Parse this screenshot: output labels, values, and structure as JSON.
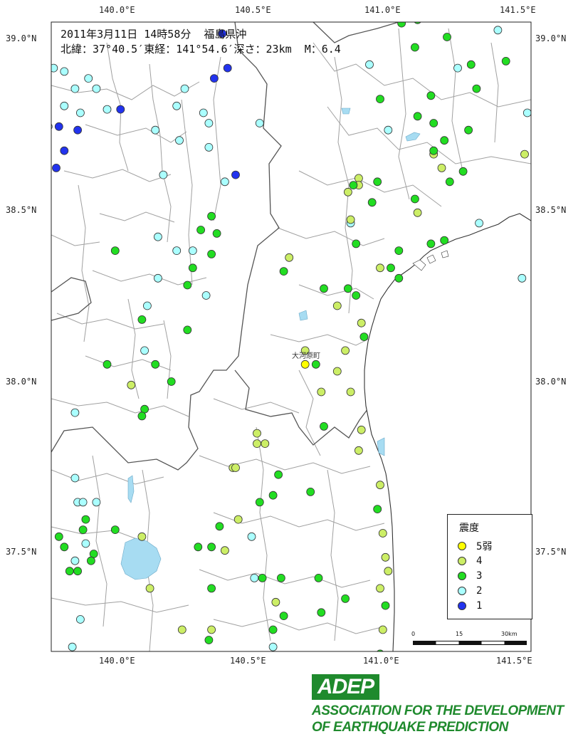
{
  "header": {
    "line1": "2011年3月11日 14時58分  福島県沖",
    "line2": "北緯：37°40.5′東経：141°54.6′深さ：23km  M：6.4"
  },
  "axes": {
    "top_lon": [
      "140.0°E",
      "140.5°E",
      "141.0°E",
      "141.5°E"
    ],
    "bottom_lon": [
      "140.0°E",
      "140.5°E",
      "141.0°E",
      "141.5°E"
    ],
    "left_lat": [
      "39.0°N",
      "38.5°N",
      "38.0°N",
      "37.5°N"
    ],
    "right_lat": [
      "39.0°N",
      "38.5°N",
      "38.0°N",
      "37.5°N"
    ]
  },
  "town_label": "大河原町",
  "legend": {
    "title": "震度",
    "items": [
      {
        "label": "5弱",
        "color": "#ffff00"
      },
      {
        "label": "4",
        "color": "#ccee66"
      },
      {
        "label": "3",
        "color": "#22dd22"
      },
      {
        "label": "2",
        "color": "#aaffff"
      },
      {
        "label": "1",
        "color": "#2233ee"
      }
    ]
  },
  "scale": {
    "labels": [
      "0",
      "15",
      "30km"
    ]
  },
  "logo": {
    "text": "ADEP",
    "line1": "ASSOCIATION FOR THE DEVELOPMENT",
    "line2": "OF EARTHQUAKE PREDICTION"
  },
  "colors": {
    "five_weak": "#ffff00",
    "four": "#ccee66",
    "three": "#22dd22",
    "two": "#aaffff",
    "one": "#2233ee",
    "sea": "#ffffff",
    "lake": "#a7dcf2",
    "border_fine": "#9a9a9a",
    "border_major": "#555555"
  },
  "stations": [
    {
      "lon": 140.72,
      "lat": 38.05,
      "i": "5-"
    },
    {
      "lon": 140.41,
      "lat": 39.01,
      "i": "1"
    },
    {
      "lon": 140.43,
      "lat": 38.91,
      "i": "1"
    },
    {
      "lon": 140.38,
      "lat": 38.88,
      "i": "1"
    },
    {
      "lon": 140.03,
      "lat": 38.79,
      "i": "1"
    },
    {
      "lon": 139.8,
      "lat": 38.74,
      "i": "1"
    },
    {
      "lon": 139.87,
      "lat": 38.73,
      "i": "1"
    },
    {
      "lon": 139.82,
      "lat": 38.67,
      "i": "1"
    },
    {
      "lon": 139.79,
      "lat": 38.62,
      "i": "1"
    },
    {
      "lon": 140.46,
      "lat": 38.6,
      "i": "1"
    },
    {
      "lon": 139.78,
      "lat": 38.91,
      "i": "2"
    },
    {
      "lon": 139.82,
      "lat": 38.9,
      "i": "2"
    },
    {
      "lon": 139.91,
      "lat": 38.88,
      "i": "2"
    },
    {
      "lon": 139.86,
      "lat": 38.85,
      "i": "2"
    },
    {
      "lon": 139.94,
      "lat": 38.85,
      "i": "2"
    },
    {
      "lon": 139.82,
      "lat": 38.8,
      "i": "2"
    },
    {
      "lon": 139.88,
      "lat": 38.78,
      "i": "2"
    },
    {
      "lon": 139.98,
      "lat": 38.79,
      "i": "2"
    },
    {
      "lon": 139.76,
      "lat": 38.74,
      "i": "2"
    },
    {
      "lon": 140.27,
      "lat": 38.85,
      "i": "2"
    },
    {
      "lon": 140.24,
      "lat": 38.8,
      "i": "2"
    },
    {
      "lon": 140.34,
      "lat": 38.78,
      "i": "2"
    },
    {
      "lon": 140.36,
      "lat": 38.75,
      "i": "2"
    },
    {
      "lon": 140.16,
      "lat": 38.73,
      "i": "2"
    },
    {
      "lon": 140.25,
      "lat": 38.7,
      "i": "2"
    },
    {
      "lon": 140.36,
      "lat": 38.68,
      "i": "2"
    },
    {
      "lon": 140.55,
      "lat": 38.75,
      "i": "2"
    },
    {
      "lon": 140.19,
      "lat": 38.6,
      "i": "2"
    },
    {
      "lon": 140.42,
      "lat": 38.58,
      "i": "2"
    },
    {
      "lon": 140.17,
      "lat": 38.42,
      "i": "2"
    },
    {
      "lon": 140.24,
      "lat": 38.38,
      "i": "2"
    },
    {
      "lon": 140.3,
      "lat": 38.38,
      "i": "2"
    },
    {
      "lon": 140.17,
      "lat": 38.3,
      "i": "2"
    },
    {
      "lon": 140.35,
      "lat": 38.25,
      "i": "2"
    },
    {
      "lon": 140.13,
      "lat": 38.22,
      "i": "2"
    },
    {
      "lon": 140.12,
      "lat": 38.09,
      "i": "2"
    },
    {
      "lon": 139.86,
      "lat": 37.91,
      "i": "2"
    },
    {
      "lon": 139.86,
      "lat": 37.72,
      "i": "2"
    },
    {
      "lon": 139.87,
      "lat": 37.65,
      "i": "2"
    },
    {
      "lon": 139.89,
      "lat": 37.65,
      "i": "2"
    },
    {
      "lon": 139.94,
      "lat": 37.65,
      "i": "2"
    },
    {
      "lon": 139.74,
      "lat": 37.63,
      "i": "2"
    },
    {
      "lon": 139.9,
      "lat": 37.53,
      "i": "2"
    },
    {
      "lon": 139.86,
      "lat": 37.48,
      "i": "2"
    },
    {
      "lon": 139.88,
      "lat": 37.31,
      "i": "2"
    },
    {
      "lon": 139.85,
      "lat": 37.23,
      "i": "2"
    },
    {
      "lon": 140.52,
      "lat": 37.55,
      "i": "2"
    },
    {
      "lon": 140.53,
      "lat": 37.43,
      "i": "2"
    },
    {
      "lon": 140.96,
      "lat": 38.92,
      "i": "2"
    },
    {
      "lon": 141.03,
      "lat": 38.73,
      "i": "2"
    },
    {
      "lon": 140.89,
      "lat": 38.46,
      "i": "2"
    },
    {
      "lon": 141.29,
      "lat": 38.91,
      "i": "2"
    },
    {
      "lon": 141.44,
      "lat": 39.02,
      "i": "2"
    },
    {
      "lon": 141.55,
      "lat": 38.78,
      "i": "2"
    },
    {
      "lon": 141.37,
      "lat": 38.46,
      "i": "2"
    },
    {
      "lon": 141.53,
      "lat": 38.3,
      "i": "2"
    },
    {
      "lon": 140.6,
      "lat": 37.23,
      "i": "2"
    },
    {
      "lon": 141.2,
      "lat": 38.66,
      "i": "4"
    },
    {
      "lon": 141.23,
      "lat": 38.62,
      "i": "4"
    },
    {
      "lon": 141.14,
      "lat": 38.49,
      "i": "4"
    },
    {
      "lon": 140.92,
      "lat": 38.59,
      "i": "4"
    },
    {
      "lon": 140.88,
      "lat": 38.55,
      "i": "4"
    },
    {
      "lon": 140.92,
      "lat": 38.57,
      "i": "4"
    },
    {
      "lon": 140.89,
      "lat": 38.47,
      "i": "4"
    },
    {
      "lon": 141.0,
      "lat": 38.33,
      "i": "4"
    },
    {
      "lon": 140.66,
      "lat": 38.36,
      "i": "4"
    },
    {
      "lon": 140.84,
      "lat": 38.22,
      "i": "4"
    },
    {
      "lon": 140.93,
      "lat": 38.17,
      "i": "4"
    },
    {
      "lon": 140.87,
      "lat": 38.09,
      "i": "4"
    },
    {
      "lon": 140.72,
      "lat": 38.09,
      "i": "4"
    },
    {
      "lon": 140.84,
      "lat": 38.03,
      "i": "4"
    },
    {
      "lon": 140.78,
      "lat": 37.97,
      "i": "4"
    },
    {
      "lon": 140.89,
      "lat": 37.97,
      "i": "4"
    },
    {
      "lon": 140.93,
      "lat": 37.86,
      "i": "4"
    },
    {
      "lon": 140.92,
      "lat": 37.8,
      "i": "4"
    },
    {
      "lon": 140.54,
      "lat": 37.85,
      "i": "4"
    },
    {
      "lon": 140.54,
      "lat": 37.82,
      "i": "4"
    },
    {
      "lon": 140.57,
      "lat": 37.82,
      "i": "4"
    },
    {
      "lon": 140.45,
      "lat": 37.75,
      "i": "4"
    },
    {
      "lon": 140.46,
      "lat": 37.75,
      "i": "4"
    },
    {
      "lon": 140.47,
      "lat": 37.6,
      "i": "4"
    },
    {
      "lon": 140.42,
      "lat": 37.51,
      "i": "4"
    },
    {
      "lon": 141.0,
      "lat": 37.7,
      "i": "4"
    },
    {
      "lon": 141.01,
      "lat": 37.56,
      "i": "4"
    },
    {
      "lon": 141.02,
      "lat": 37.49,
      "i": "4"
    },
    {
      "lon": 141.03,
      "lat": 37.45,
      "i": "4"
    },
    {
      "lon": 141.0,
      "lat": 37.4,
      "i": "4"
    },
    {
      "lon": 140.11,
      "lat": 37.55,
      "i": "4"
    },
    {
      "lon": 140.14,
      "lat": 37.4,
      "i": "4"
    },
    {
      "lon": 140.07,
      "lat": 37.99,
      "i": "4"
    },
    {
      "lon": 140.26,
      "lat": 37.28,
      "i": "4"
    },
    {
      "lon": 140.37,
      "lat": 37.28,
      "i": "4"
    },
    {
      "lon": 140.61,
      "lat": 37.36,
      "i": "4"
    },
    {
      "lon": 141.01,
      "lat": 37.28,
      "i": "4"
    },
    {
      "lon": 141.54,
      "lat": 38.66,
      "i": "4"
    },
    {
      "lon": 141.08,
      "lat": 39.04,
      "i": "3"
    },
    {
      "lon": 141.14,
      "lat": 39.05,
      "i": "3"
    },
    {
      "lon": 141.25,
      "lat": 39.0,
      "i": "3"
    },
    {
      "lon": 141.13,
      "lat": 38.97,
      "i": "3"
    },
    {
      "lon": 141.34,
      "lat": 38.92,
      "i": "3"
    },
    {
      "lon": 141.47,
      "lat": 38.93,
      "i": "3"
    },
    {
      "lon": 141.36,
      "lat": 38.85,
      "i": "3"
    },
    {
      "lon": 141.19,
      "lat": 38.83,
      "i": "3"
    },
    {
      "lon": 141.0,
      "lat": 38.82,
      "i": "3"
    },
    {
      "lon": 141.14,
      "lat": 38.77,
      "i": "3"
    },
    {
      "lon": 141.2,
      "lat": 38.75,
      "i": "3"
    },
    {
      "lon": 141.33,
      "lat": 38.73,
      "i": "3"
    },
    {
      "lon": 141.24,
      "lat": 38.7,
      "i": "3"
    },
    {
      "lon": 141.2,
      "lat": 38.67,
      "i": "3"
    },
    {
      "lon": 141.31,
      "lat": 38.61,
      "i": "3"
    },
    {
      "lon": 141.26,
      "lat": 38.58,
      "i": "3"
    },
    {
      "lon": 140.99,
      "lat": 38.58,
      "i": "3"
    },
    {
      "lon": 140.9,
      "lat": 38.57,
      "i": "3"
    },
    {
      "lon": 141.13,
      "lat": 38.53,
      "i": "3"
    },
    {
      "lon": 140.97,
      "lat": 38.52,
      "i": "3"
    },
    {
      "lon": 141.24,
      "lat": 38.41,
      "i": "3"
    },
    {
      "lon": 141.19,
      "lat": 38.4,
      "i": "3"
    },
    {
      "lon": 140.91,
      "lat": 38.4,
      "i": "3"
    },
    {
      "lon": 141.07,
      "lat": 38.38,
      "i": "3"
    },
    {
      "lon": 141.04,
      "lat": 38.33,
      "i": "3"
    },
    {
      "lon": 141.07,
      "lat": 38.3,
      "i": "3"
    },
    {
      "lon": 140.64,
      "lat": 38.32,
      "i": "3"
    },
    {
      "lon": 140.79,
      "lat": 38.27,
      "i": "3"
    },
    {
      "lon": 140.88,
      "lat": 38.27,
      "i": "3"
    },
    {
      "lon": 140.91,
      "lat": 38.25,
      "i": "3"
    },
    {
      "lon": 140.94,
      "lat": 38.13,
      "i": "3"
    },
    {
      "lon": 140.76,
      "lat": 38.05,
      "i": "3"
    },
    {
      "lon": 140.79,
      "lat": 37.87,
      "i": "3"
    },
    {
      "lon": 140.62,
      "lat": 37.73,
      "i": "3"
    },
    {
      "lon": 140.74,
      "lat": 37.68,
      "i": "3"
    },
    {
      "lon": 140.6,
      "lat": 37.67,
      "i": "3"
    },
    {
      "lon": 140.55,
      "lat": 37.65,
      "i": "3"
    },
    {
      "lon": 140.4,
      "lat": 37.58,
      "i": "3"
    },
    {
      "lon": 140.37,
      "lat": 37.52,
      "i": "3"
    },
    {
      "lon": 140.32,
      "lat": 37.52,
      "i": "3"
    },
    {
      "lon": 140.99,
      "lat": 37.63,
      "i": "3"
    },
    {
      "lon": 140.56,
      "lat": 37.43,
      "i": "3"
    },
    {
      "lon": 140.63,
      "lat": 37.43,
      "i": "3"
    },
    {
      "lon": 140.77,
      "lat": 37.43,
      "i": "3"
    },
    {
      "lon": 140.37,
      "lat": 37.4,
      "i": "3"
    },
    {
      "lon": 140.87,
      "lat": 37.37,
      "i": "3"
    },
    {
      "lon": 141.02,
      "lat": 37.35,
      "i": "3"
    },
    {
      "lon": 140.78,
      "lat": 37.33,
      "i": "3"
    },
    {
      "lon": 140.64,
      "lat": 37.32,
      "i": "3"
    },
    {
      "lon": 140.6,
      "lat": 37.28,
      "i": "3"
    },
    {
      "lon": 140.36,
      "lat": 37.25,
      "i": "3"
    },
    {
      "lon": 140.54,
      "lat": 37.2,
      "i": "3"
    },
    {
      "lon": 141.0,
      "lat": 37.21,
      "i": "3"
    },
    {
      "lon": 141.0,
      "lat": 37.19,
      "i": "3"
    },
    {
      "lon": 140.23,
      "lat": 37.19,
      "i": "3"
    },
    {
      "lon": 140.36,
      "lat": 37.19,
      "i": "3"
    },
    {
      "lon": 140.41,
      "lat": 37.19,
      "i": "3"
    },
    {
      "lon": 140.37,
      "lat": 38.48,
      "i": "3"
    },
    {
      "lon": 140.33,
      "lat": 38.44,
      "i": "3"
    },
    {
      "lon": 140.39,
      "lat": 38.43,
      "i": "3"
    },
    {
      "lon": 140.37,
      "lat": 38.37,
      "i": "3"
    },
    {
      "lon": 140.3,
      "lat": 38.33,
      "i": "3"
    },
    {
      "lon": 140.28,
      "lat": 38.28,
      "i": "3"
    },
    {
      "lon": 140.01,
      "lat": 38.38,
      "i": "3"
    },
    {
      "lon": 140.11,
      "lat": 38.18,
      "i": "3"
    },
    {
      "lon": 140.28,
      "lat": 38.15,
      "i": "3"
    },
    {
      "lon": 139.98,
      "lat": 38.05,
      "i": "3"
    },
    {
      "lon": 140.16,
      "lat": 38.05,
      "i": "3"
    },
    {
      "lon": 140.22,
      "lat": 38.0,
      "i": "3"
    },
    {
      "lon": 139.74,
      "lat": 38.05,
      "i": "3"
    },
    {
      "lon": 140.12,
      "lat": 37.92,
      "i": "3"
    },
    {
      "lon": 140.11,
      "lat": 37.9,
      "i": "3"
    },
    {
      "lon": 139.9,
      "lat": 37.6,
      "i": "3"
    },
    {
      "lon": 139.89,
      "lat": 37.57,
      "i": "3"
    },
    {
      "lon": 140.01,
      "lat": 37.57,
      "i": "3"
    },
    {
      "lon": 139.8,
      "lat": 37.55,
      "i": "3"
    },
    {
      "lon": 139.82,
      "lat": 37.52,
      "i": "3"
    },
    {
      "lon": 139.93,
      "lat": 37.5,
      "i": "3"
    },
    {
      "lon": 139.92,
      "lat": 37.48,
      "i": "3"
    },
    {
      "lon": 139.84,
      "lat": 37.45,
      "i": "3"
    },
    {
      "lon": 139.87,
      "lat": 37.45,
      "i": "3"
    }
  ]
}
